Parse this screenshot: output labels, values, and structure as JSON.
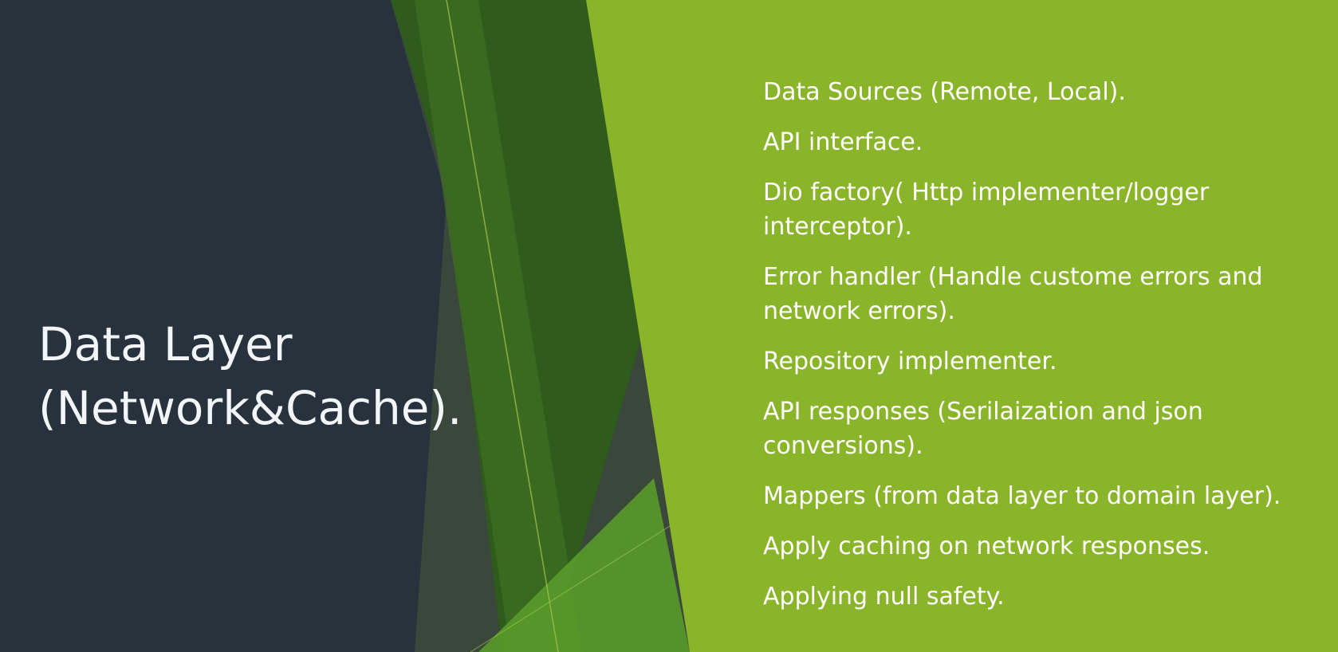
{
  "slide": {
    "title_lines": [
      "Data Layer",
      "(Network&Cache)."
    ],
    "bullets": [
      "Data Sources (Remote, Local).",
      "API interface.",
      "Dio factory( Http implementer/logger interceptor).",
      "Error handler (Handle custome errors and network errors).",
      "Repository implementer.",
      "API responses (Serilaization and json conversions).",
      "Mappers (from data layer to domain layer).",
      "Apply caching on network responses.",
      "Applying null safety."
    ]
  },
  "colors": {
    "dark_panel": "#27323d",
    "green_panel": "#8ab52a",
    "dark_green": "#3b6a1d",
    "title_text": "#f3f6f8",
    "bullet_text": "#ffffff"
  }
}
